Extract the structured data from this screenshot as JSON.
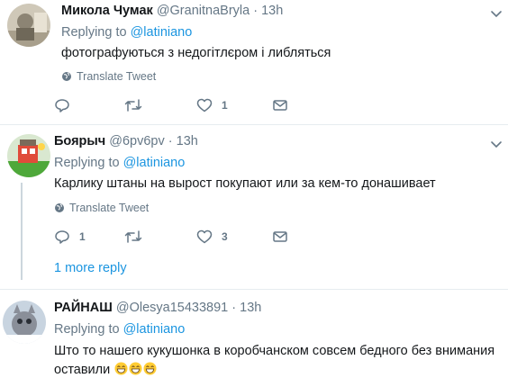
{
  "tweets": [
    {
      "name": "Микола Чумак",
      "handle": "@GranitnaBryla",
      "separator": "·",
      "time": "13h",
      "replying_prefix": "Replying to",
      "replying_to": "@latiniano",
      "text": "фотографуються з недогітлєром і либляться",
      "translate": "Translate Tweet",
      "replies": "",
      "retweets": "",
      "likes": "1"
    },
    {
      "name": "Боярыч",
      "handle": "@6pv6pv",
      "separator": "·",
      "time": "13h",
      "replying_prefix": "Replying to",
      "replying_to": "@latiniano",
      "text": "Карлику штаны на вырост покупают или за кем-то донашивает",
      "translate": "Translate Tweet",
      "replies": "1",
      "retweets": "",
      "likes": "3",
      "more_replies": "1 more reply"
    },
    {
      "name": "РАЙНАШ",
      "handle": "@Olesya15433891",
      "separator": "·",
      "time": "13h",
      "replying_prefix": "Replying to",
      "replying_to": "@latiniano",
      "text_line1": "Што то нашего кукушонка в коробчанском совсем бедного без внимания",
      "text_line2": "оставили"
    }
  ],
  "colors": {
    "link": "#1b95e0",
    "muted": "#657786",
    "divider": "#e6ecf0",
    "thread_line": "#ccd6dd"
  },
  "icons": [
    "reply-icon",
    "retweet-icon",
    "like-icon",
    "message-icon",
    "globe-icon",
    "chevron-down-icon",
    "grinning-emoji-icon"
  ]
}
